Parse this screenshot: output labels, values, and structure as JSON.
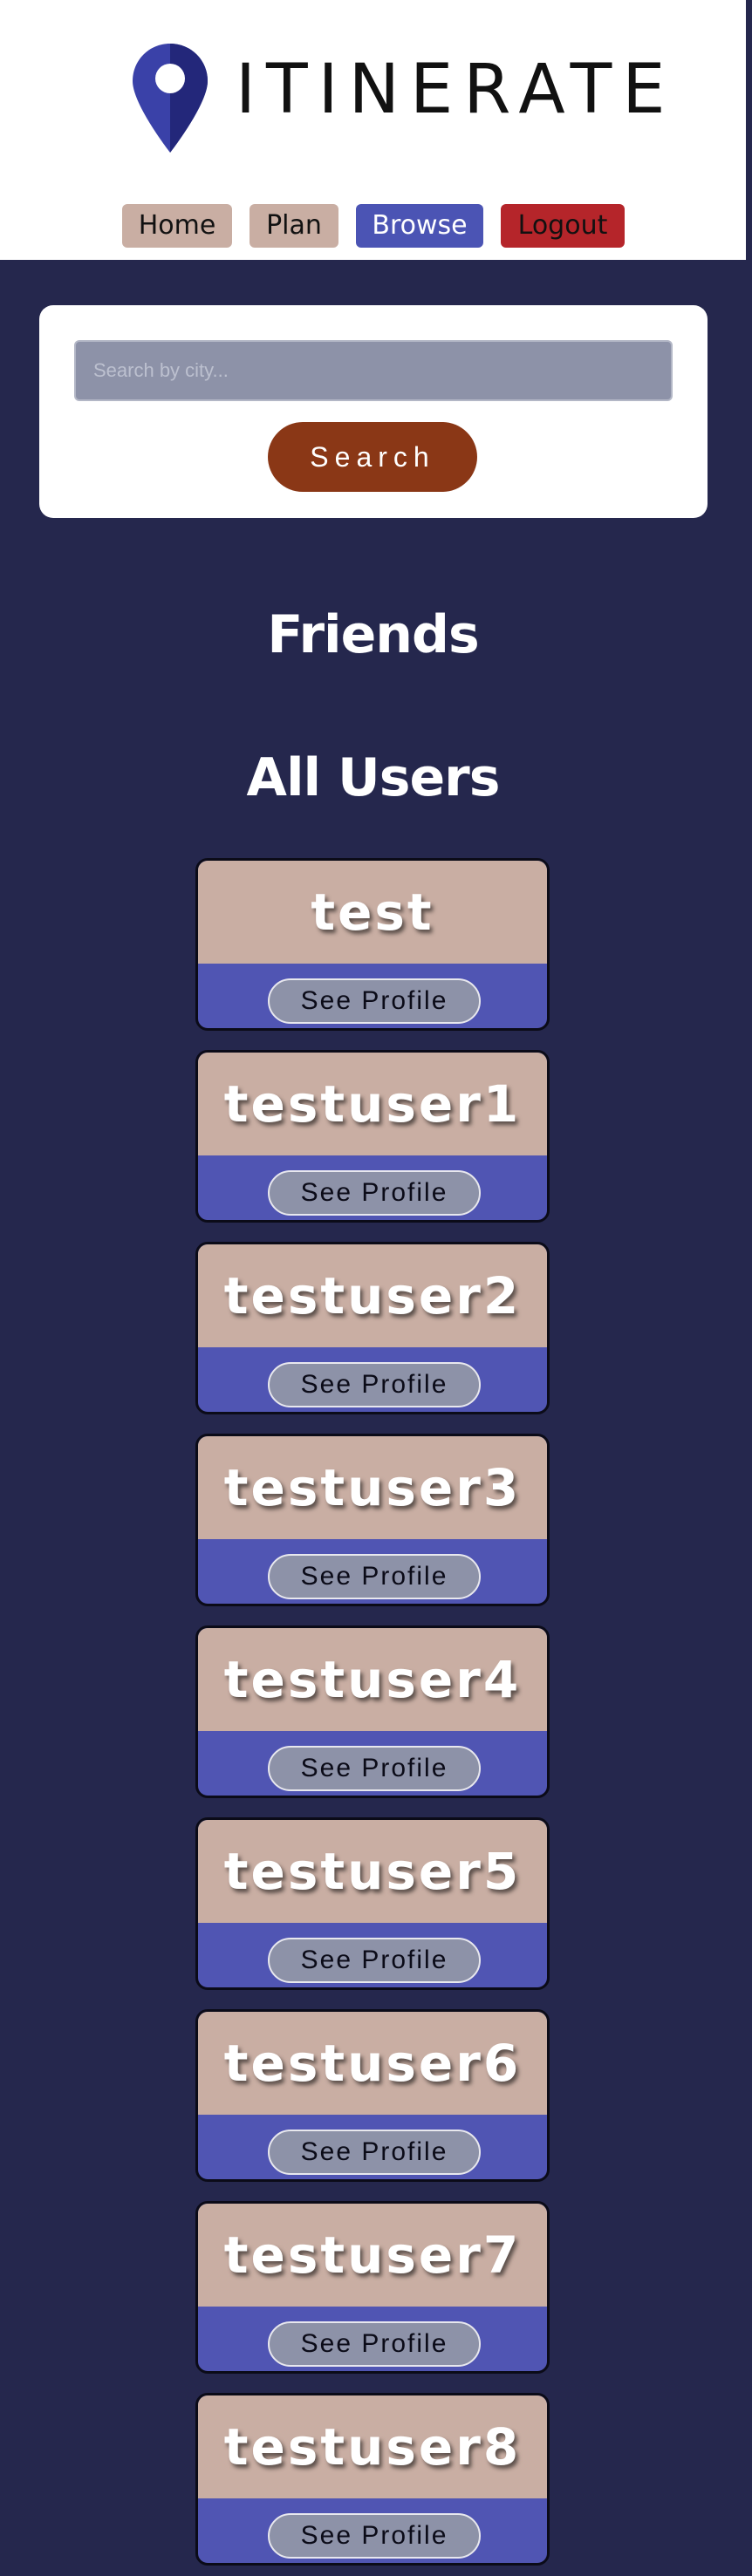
{
  "brand": {
    "name": "ITINERATE"
  },
  "nav": {
    "home": "Home",
    "plan": "Plan",
    "browse": "Browse",
    "logout": "Logout"
  },
  "search": {
    "placeholder": "Search by city...",
    "button_label": "Search"
  },
  "sections": {
    "friends": "Friends",
    "all_users": "All Users"
  },
  "users": [
    {
      "name": "test",
      "action": "See Profile"
    },
    {
      "name": "testuser1",
      "action": "See Profile"
    },
    {
      "name": "testuser2",
      "action": "See Profile"
    },
    {
      "name": "testuser3",
      "action": "See Profile"
    },
    {
      "name": "testuser4",
      "action": "See Profile"
    },
    {
      "name": "testuser5",
      "action": "See Profile"
    },
    {
      "name": "testuser6",
      "action": "See Profile"
    },
    {
      "name": "testuser7",
      "action": "See Profile"
    },
    {
      "name": "testuser8",
      "action": "See Profile"
    }
  ],
  "colors": {
    "page_background": "#25274d",
    "card_top": "#c9aea3",
    "card_bottom": "#5055b3",
    "browse_active": "#4b54b4",
    "logout": "#b5252a",
    "search_button": "#8a3716"
  },
  "icons": {
    "logo": "map-pin-icon"
  }
}
